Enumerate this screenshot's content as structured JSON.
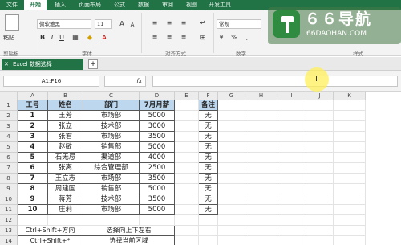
{
  "ribbon_tabs": [
    "文件",
    "开始",
    "插入",
    "页面布局",
    "公式",
    "数据",
    "审阅",
    "视图",
    "开发工具"
  ],
  "ribbon": {
    "paste_label": "粘贴",
    "clipboard_label": "剪贴板",
    "font_name": "微软雅黑",
    "font_size": "11",
    "font_group_label": "字体",
    "align_group_label": "对齐方式",
    "number_format": "常规",
    "number_group_label": "数字",
    "style_group_label": "样式"
  },
  "watermark": {
    "title": "６６导航",
    "domain": "66DAOHAN.COM"
  },
  "doc_tab": {
    "title": "Excel 数据选择"
  },
  "formula_bar": {
    "name_box": "A1:F16",
    "fx": "fx",
    "formula": ""
  },
  "columns": [
    "A",
    "B",
    "C",
    "D",
    "E",
    "F",
    "G",
    "H",
    "I",
    "J",
    "K"
  ],
  "rows": [
    "1",
    "2",
    "3",
    "4",
    "5",
    "6",
    "7",
    "8",
    "9",
    "10",
    "11",
    "12",
    "13",
    "14"
  ],
  "table": {
    "headers": [
      "工号",
      "姓名",
      "部门",
      "7月月薪"
    ],
    "note_header": "备注",
    "rows": [
      [
        "1",
        "王芳",
        "市场部",
        "5000",
        "无"
      ],
      [
        "2",
        "张立",
        "技术部",
        "3000",
        "无"
      ],
      [
        "3",
        "张君",
        "市场部",
        "3500",
        "无"
      ],
      [
        "4",
        "赵敏",
        "销售部",
        "5000",
        "无"
      ],
      [
        "5",
        "石无忌",
        "渠道部",
        "4000",
        "无"
      ],
      [
        "6",
        "张离",
        "综合管理部",
        "2500",
        "无"
      ],
      [
        "7",
        "王立志",
        "市场部",
        "3500",
        "无"
      ],
      [
        "8",
        "周建国",
        "销售部",
        "5000",
        "无"
      ],
      [
        "9",
        "蒋芳",
        "技术部",
        "3500",
        "无"
      ],
      [
        "10",
        "庄莉",
        "市场部",
        "5000",
        "无"
      ]
    ]
  },
  "shortcuts": [
    {
      "keys": "Ctrl+Shift+方向",
      "desc": "选择向上下左右"
    },
    {
      "keys": "Ctrl+Shift+*",
      "desc": "选择当前区域"
    }
  ]
}
